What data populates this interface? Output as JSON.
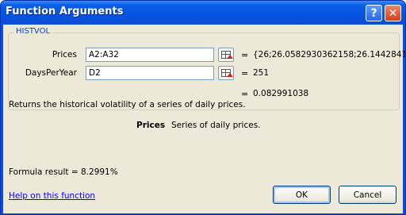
{
  "window": {
    "title": "Function Arguments",
    "help_glyph": "?",
    "close_glyph": "✕"
  },
  "function_group": {
    "label": "HISTVOL",
    "arguments": [
      {
        "label": "Prices",
        "value": "A2:A32",
        "result": "{26;26.0582930362158;26.14428411"
      },
      {
        "label": "DaysPerYear",
        "value": "D2",
        "result": "251"
      }
    ],
    "overall_result": "0.082991038"
  },
  "description": "Returns the historical volatility of a series of daily prices.",
  "argument_help": {
    "name": "Prices",
    "text": "Series of daily prices."
  },
  "formula": {
    "label": "Formula result =",
    "value": "8.2991%"
  },
  "footer": {
    "help_link": "Help on this function",
    "ok_label": "OK",
    "cancel_label": "Cancel"
  },
  "equals_sign": "=",
  "icons": {
    "help": "help-icon",
    "close": "close-icon",
    "collapse": "collapse-dialog-icon"
  }
}
